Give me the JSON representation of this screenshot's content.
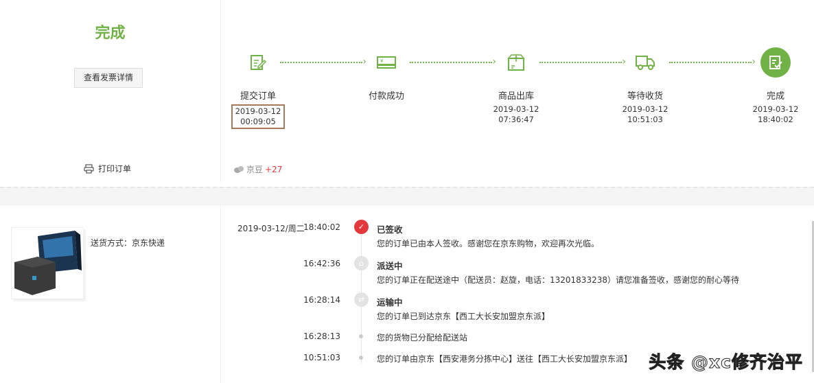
{
  "order": {
    "status": "完成",
    "invoice_button": "查看发票详情",
    "print_label": "打印订单"
  },
  "progress": {
    "steps": [
      {
        "label": "提交订单",
        "date": "2019-03-12",
        "time": "00:09:05"
      },
      {
        "label": "付款成功",
        "date": "",
        "time": ""
      },
      {
        "label": "商品出库",
        "date": "2019-03-12",
        "time": "07:36:47"
      },
      {
        "label": "等待收货",
        "date": "2019-03-12",
        "time": "10:51:03"
      },
      {
        "label": "完成",
        "date": "2019-03-12",
        "time": "18:40:02"
      }
    ],
    "jingdou_label": "京豆",
    "jingdou_value": "+27"
  },
  "shipping": {
    "method": "送货方式：京东快递",
    "date": "2019-03-12/周二",
    "events": [
      {
        "time": "18:40:02",
        "title": "已签收",
        "desc": "您的订单已由本人签收。感谢您在京东购物，欢迎再次光临。"
      },
      {
        "time": "16:42:36",
        "title": "派送中",
        "desc": "您的订单正在配送途中（配送员：赵旋，电话：13201833238）请您准备签收，感谢您的耐心等待"
      },
      {
        "time": "16:28:14",
        "title": "运输中",
        "desc": "您的订单已到达京东【西工大长安加盟京东派】"
      },
      {
        "time": "16:28:13",
        "title": "",
        "desc": "您的货物已分配给配送站"
      },
      {
        "time": "10:51:03",
        "title": "",
        "desc": "您的订单由京东【西安港务分拣中心】送往【西工大长安加盟京东派】"
      }
    ]
  },
  "watermark": "头条 @xc修齐治平",
  "colors": {
    "accent": "#71b247",
    "signed": "#e4393c",
    "highlight": "#a8785a"
  }
}
